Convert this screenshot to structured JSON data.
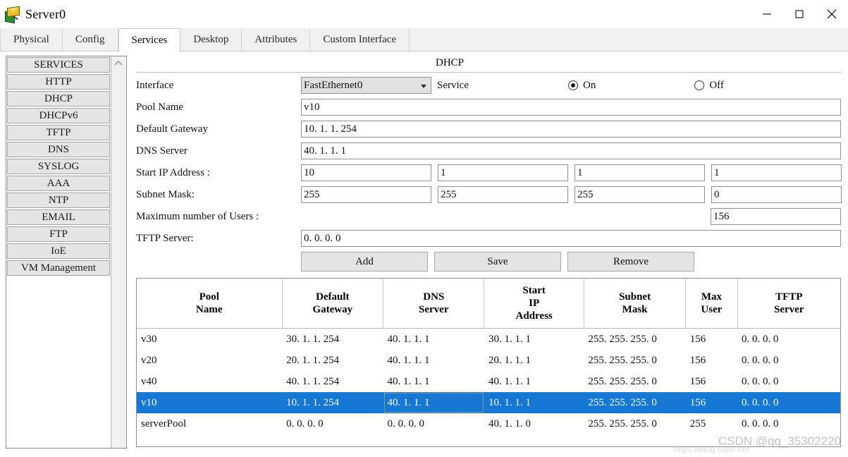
{
  "window": {
    "title": "Server0",
    "icon": "server-mail-icon",
    "controls": {
      "minimize": "minimize-icon",
      "maximize": "maximize-icon",
      "close": "close-icon"
    }
  },
  "tabs": [
    {
      "label": "Physical",
      "active": false
    },
    {
      "label": "Config",
      "active": false
    },
    {
      "label": "Services",
      "active": true
    },
    {
      "label": "Desktop",
      "active": false
    },
    {
      "label": "Attributes",
      "active": false
    },
    {
      "label": "Custom Interface",
      "active": false
    }
  ],
  "sidebar": {
    "items": [
      {
        "label": "SERVICES"
      },
      {
        "label": "HTTP"
      },
      {
        "label": "DHCP"
      },
      {
        "label": "DHCPv6"
      },
      {
        "label": "TFTP"
      },
      {
        "label": "DNS"
      },
      {
        "label": "SYSLOG"
      },
      {
        "label": "AAA"
      },
      {
        "label": "NTP"
      },
      {
        "label": "EMAIL"
      },
      {
        "label": "FTP"
      },
      {
        "label": "IoE"
      },
      {
        "label": "VM Management"
      }
    ],
    "scroll_up_icon": "chevron-up-icon"
  },
  "panel": {
    "title": "DHCP",
    "interface": {
      "label": "Interface",
      "value": "FastEthernet0"
    },
    "service": {
      "label": "Service",
      "on_label": "On",
      "off_label": "Off",
      "selected": "On"
    },
    "pool_name": {
      "label": "Pool Name",
      "value": "v10"
    },
    "default_gateway": {
      "label": "Default Gateway",
      "value": "10. 1. 1. 254"
    },
    "dns_server": {
      "label": "DNS Server",
      "value": "40. 1. 1. 1"
    },
    "start_ip": {
      "label": "Start IP Address :",
      "octets": [
        "10",
        "1",
        "1",
        "1"
      ]
    },
    "subnet_mask": {
      "label": "Subnet Mask:",
      "octets": [
        "255",
        "255",
        "255",
        "0"
      ]
    },
    "max_users": {
      "label": "Maximum number of Users :",
      "value": "156"
    },
    "tftp_server": {
      "label": "TFTP Server:",
      "value": "0. 0. 0. 0"
    },
    "buttons": {
      "add": "Add",
      "save": "Save",
      "remove": "Remove"
    }
  },
  "table": {
    "headers": [
      "Pool\nName",
      "Default\nGateway",
      "DNS\nServer",
      "Start\nIP\nAddress",
      "Subnet\nMask",
      "Max\nUser",
      "TFTP\nServer"
    ],
    "rows": [
      {
        "pool_name": "v30",
        "default_gateway": "30. 1. 1. 254",
        "dns_server": "40. 1. 1. 1",
        "start_ip": "30. 1. 1. 1",
        "subnet_mask": "255. 255. 255. 0",
        "max_user": "156",
        "tftp_server": "0. 0. 0. 0",
        "selected": false
      },
      {
        "pool_name": "v20",
        "default_gateway": "20. 1. 1. 254",
        "dns_server": "40. 1. 1. 1",
        "start_ip": "20. 1. 1. 1",
        "subnet_mask": "255. 255. 255. 0",
        "max_user": "156",
        "tftp_server": "0. 0. 0. 0",
        "selected": false
      },
      {
        "pool_name": "v40",
        "default_gateway": "40. 1. 1. 254",
        "dns_server": "40. 1. 1. 1",
        "start_ip": "40. 1. 1. 1",
        "subnet_mask": "255. 255. 255. 0",
        "max_user": "156",
        "tftp_server": "0. 0. 0. 0",
        "selected": false
      },
      {
        "pool_name": "v10",
        "default_gateway": "10. 1. 1. 254",
        "dns_server": "40. 1. 1. 1",
        "start_ip": "10. 1. 1. 1",
        "subnet_mask": "255. 255. 255. 0",
        "max_user": "156",
        "tftp_server": "0. 0. 0. 0",
        "selected": true
      },
      {
        "pool_name": "serverPool",
        "default_gateway": "0. 0. 0. 0",
        "dns_server": "0. 0. 0. 0",
        "start_ip": "40. 1. 1. 0",
        "subnet_mask": "255. 255. 255. 0",
        "max_user": "255",
        "tftp_server": "0. 0. 0. 0",
        "selected": false
      }
    ]
  },
  "watermark": {
    "main": "CSDN @qq_35302220",
    "url": "https://blog.csdn.net"
  },
  "colors": {
    "selection": "#1478d4",
    "tab_active_bg": "#ffffff",
    "panel_bg": "#f0f0f0",
    "button_bg": "#e4e4e4"
  }
}
